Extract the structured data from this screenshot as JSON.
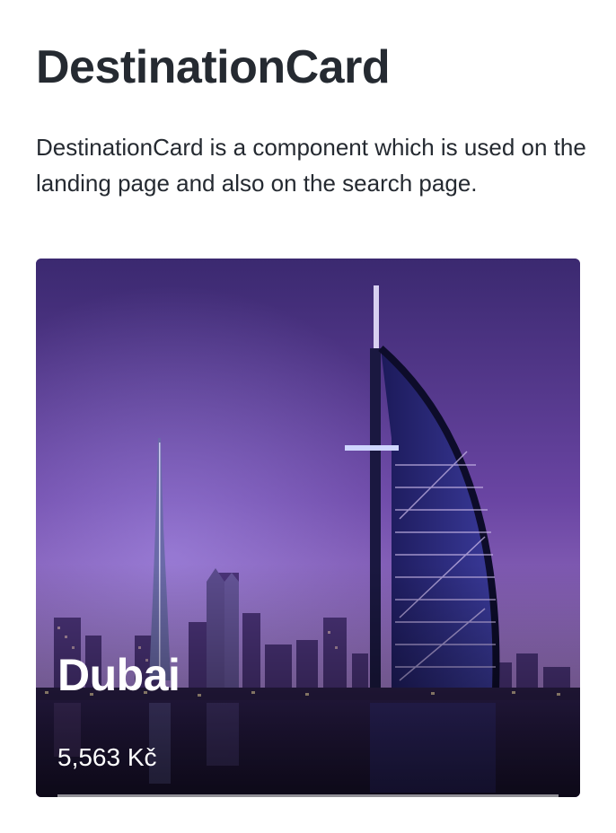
{
  "page": {
    "title": "DestinationCard",
    "description": "DestinationCard is a component which is used on the landing page and also on the search page."
  },
  "card": {
    "destination": "Dubai",
    "price": "5,563 Kč",
    "colors": {
      "sky_top": "#3d2a73",
      "sky_mid": "#7a4fae",
      "sky_bottom": "#b48ad6",
      "water": "#24183e",
      "text": "#ffffff"
    }
  }
}
